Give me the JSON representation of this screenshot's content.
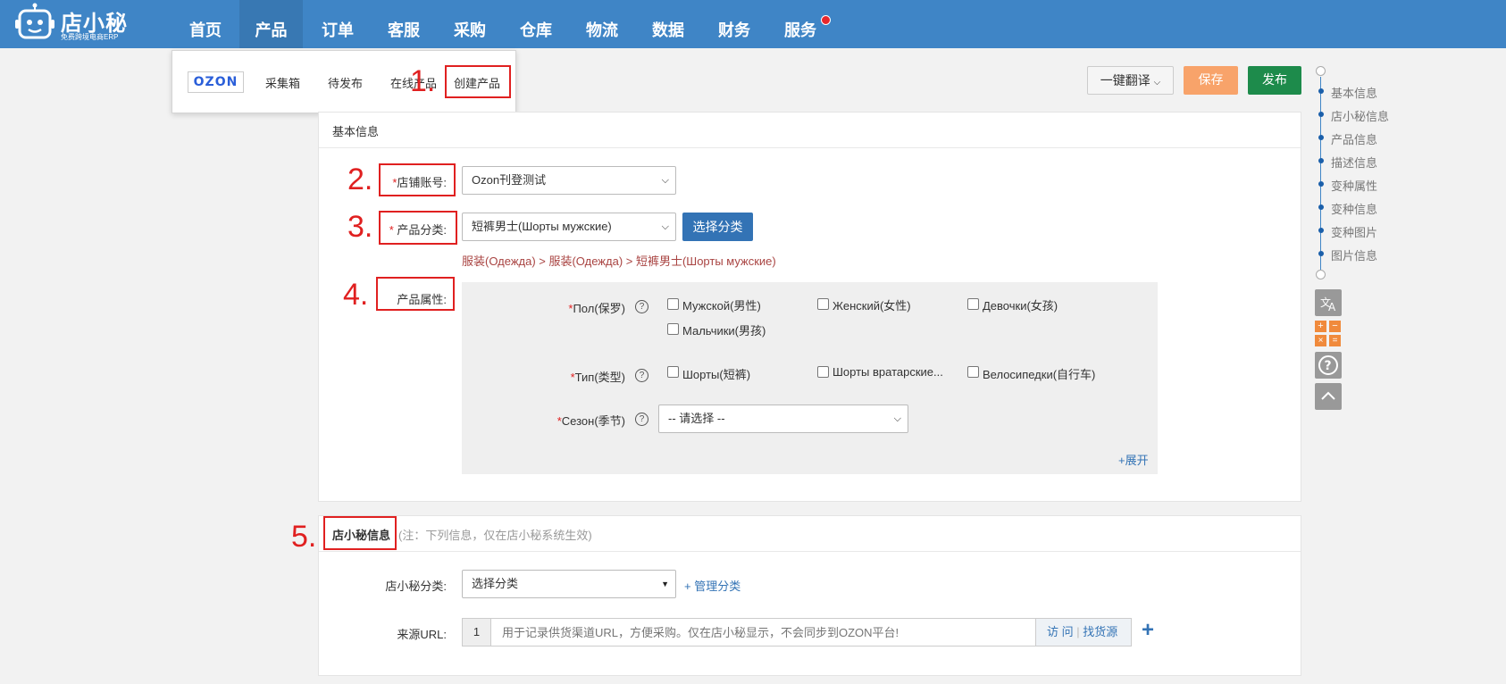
{
  "app": {
    "logo_text": "店小秘",
    "logo_subtitle": "免费跨境电商ERP"
  },
  "nav": {
    "items": [
      {
        "label": "首页"
      },
      {
        "label": "产品",
        "active": true
      },
      {
        "label": "订单"
      },
      {
        "label": "客服"
      },
      {
        "label": "采购"
      },
      {
        "label": "仓库"
      },
      {
        "label": "物流"
      },
      {
        "label": "数据"
      },
      {
        "label": "财务"
      },
      {
        "label": "服务",
        "badge_dot": true
      }
    ]
  },
  "dropdown": {
    "brand": "OZON",
    "items": [
      {
        "label": "采集箱"
      },
      {
        "label": "待发布"
      },
      {
        "label": "在线产品"
      },
      {
        "label": "创建产品",
        "highlighted": true
      }
    ]
  },
  "annotations": [
    "1.",
    "2.",
    "3.",
    "4.",
    "5."
  ],
  "toolbar": {
    "translate": "一键翻译",
    "save": "保存",
    "publish": "发布"
  },
  "anchor_nav": {
    "items": [
      "基本信息",
      "店小秘信息",
      "产品信息",
      "描述信息",
      "变种属性",
      "变种信息",
      "变种图片",
      "图片信息"
    ]
  },
  "tools": {
    "translate_icon": "translate-icon",
    "calculator_icon": "calculator-icon",
    "help_icon": "help-icon",
    "scroll_top_icon": "chevron-up-icon"
  },
  "basic_info": {
    "title": "基本信息",
    "shop_label": "店铺账号:",
    "shop_value": "Ozon刊登测试",
    "category_label": "产品分类:",
    "category_value": "短裤男士(Шорты мужские)",
    "category_button": "选择分类",
    "category_path": "服装(Одежда) > 服装(Одежда) > 短裤男士(Шорты мужские)",
    "attr_label": "产品属性:",
    "attributes": {
      "gender_label": "Пол(保罗)",
      "gender_options": [
        "Мужской(男性)",
        "Женский(女性)",
        "Девочки(女孩)",
        "Мальчики(男孩)"
      ],
      "type_label": "Тип(类型)",
      "type_options": [
        "Шорты(短裤)",
        "Шорты вратарские...",
        "Велосипедки(自行车)"
      ],
      "season_label": "Сезон(季节)",
      "season_placeholder": "-- 请选择 --",
      "expand": "+展开"
    }
  },
  "dxm_info": {
    "title": "店小秘信息",
    "note": "(注：下列信息，仅在店小秘系统生效)",
    "category_label": "店小秘分类:",
    "category_placeholder": "选择分类",
    "manage_link": "+ 管理分类",
    "source_label": "来源URL:",
    "source_index": "1",
    "source_placeholder": "用于记录供货渠道URL，方便采购。仅在店小秘显示，不会同步到OZON平台!",
    "visit": "访 问",
    "find_source": "找货源",
    "plus": "+"
  },
  "colors": {
    "header": "#3f85c6",
    "annotation_red": "#e02020",
    "save": "#f8a36a",
    "publish": "#1d8b4b",
    "primary": "#3373b5"
  }
}
